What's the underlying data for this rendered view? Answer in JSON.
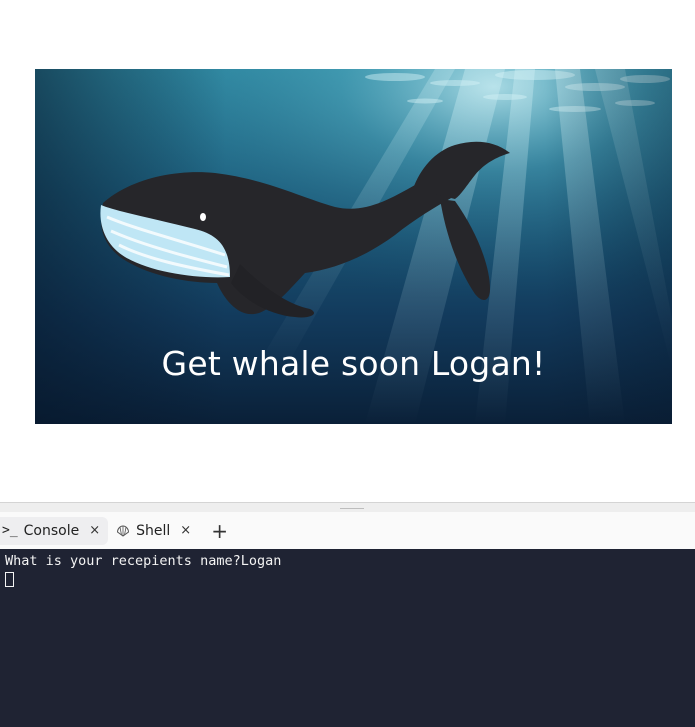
{
  "card": {
    "caption": "Get whale soon Logan!"
  },
  "tabs": [
    {
      "label": "Console",
      "icon": "terminal-prompt-icon",
      "close": "×",
      "active": true
    },
    {
      "label": "Shell",
      "icon": "shell-icon",
      "close": "×",
      "active": false
    }
  ],
  "add_tab": "+",
  "console": {
    "lines": [
      "What is your recepients name?Logan"
    ]
  },
  "colors": {
    "console_bg": "#1f2333",
    "ocean_dark": "#0b2540",
    "ocean_light": "#3a8fa8",
    "whale_body": "#26262a",
    "whale_belly": "#bfe6f5"
  }
}
